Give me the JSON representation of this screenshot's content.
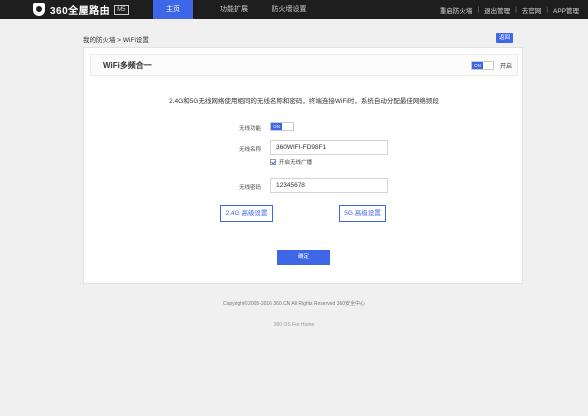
{
  "header": {
    "brand": "360全屋路由",
    "model": "M5",
    "nav": [
      {
        "label": "主页",
        "active": true
      },
      {
        "label": "功能扩展",
        "active": false
      },
      {
        "label": "防火墙设置",
        "active": false
      }
    ],
    "right_links": [
      "重启防火墙",
      "退出管理",
      "去官网",
      "APP管理"
    ]
  },
  "breadcrumb": "我的防火墙 > WiFi设置",
  "back_button": "返回",
  "card": {
    "title": "WiFi多频合一",
    "toggle_on_text": "ON",
    "toggle_state": "开启",
    "description": "2.4G和5G无线网络使用相同的无线名称和密码，终端连接WiFi时，系统自动分配最佳网络频段",
    "wireless_label": "无线功能",
    "wireless_toggle_text": "ON",
    "ssid_label": "无线名称",
    "ssid_value": "360WIFI-FD98F1",
    "hide_ssid_label": "开启无线广播",
    "password_label": "无线密码",
    "password_value": "12345678",
    "adv_24g_button": "2.4G 高级设置",
    "adv_5g_button": "5G 高级设置",
    "confirm_button": "确定"
  },
  "footer": {
    "copyright": "Copyright©2005-2016 360.CN All Rights Reserved 360安全中心",
    "link": "360 OS For Home"
  },
  "colors": {
    "accent": "#3d67e6",
    "topbar": "#1e1e1e",
    "background": "#f0f0f0"
  }
}
